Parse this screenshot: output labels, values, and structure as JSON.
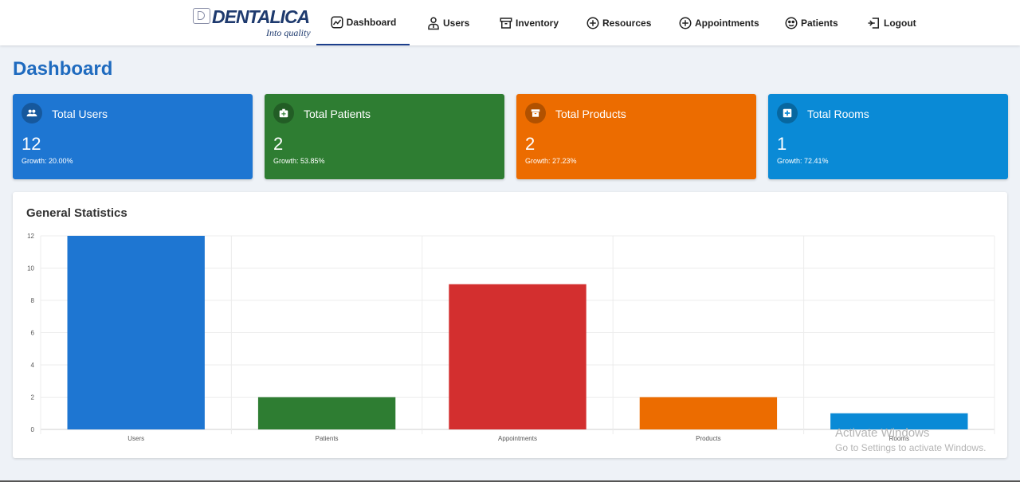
{
  "logo": {
    "word": "DENTALICA",
    "tagline": "Into quality"
  },
  "nav": {
    "items": [
      {
        "label": "Dashboard",
        "icon": "chart-line-icon",
        "active": true
      },
      {
        "label": "Users",
        "icon": "doctor-icon"
      },
      {
        "label": "Inventory",
        "icon": "archive-icon"
      },
      {
        "label": "Resources",
        "icon": "plus-circle-icon"
      },
      {
        "label": "Appointments",
        "icon": "plus-circle-icon"
      },
      {
        "label": "Patients",
        "icon": "face-icon"
      },
      {
        "label": "Logout",
        "icon": "logout-icon"
      }
    ]
  },
  "page": {
    "title": "Dashboard"
  },
  "cards": [
    {
      "title": "Total Users",
      "value": "12",
      "growth": "Growth: 20.00%",
      "color": "#1e76d2",
      "icon": "users-icon"
    },
    {
      "title": "Total Patients",
      "value": "2",
      "growth": "Growth: 53.85%",
      "color": "#2e7d32",
      "icon": "medical-bag-icon"
    },
    {
      "title": "Total Products",
      "value": "2",
      "growth": "Growth: 27.23%",
      "color": "#ec6c00",
      "icon": "archive-icon"
    },
    {
      "title": "Total Rooms",
      "value": "1",
      "growth": "Growth: 72.41%",
      "color": "#0a8ad6",
      "icon": "hospital-icon"
    }
  ],
  "stats": {
    "title": "General Statistics"
  },
  "chart_data": {
    "type": "bar",
    "categories": [
      "Users",
      "Patients",
      "Appointments",
      "Products",
      "Rooms"
    ],
    "values": [
      12,
      2,
      9,
      2,
      1
    ],
    "colors": [
      "#1e76d2",
      "#2e7d32",
      "#d32f2f",
      "#ec6c00",
      "#0a8ad6"
    ],
    "ylim": [
      0,
      12
    ],
    "yticks": [
      0,
      2,
      4,
      6,
      8,
      10,
      12
    ],
    "grid": true,
    "legend": "none"
  },
  "watermark": {
    "line1": "Activate Windows",
    "line2": "Go to Settings to activate Windows."
  }
}
